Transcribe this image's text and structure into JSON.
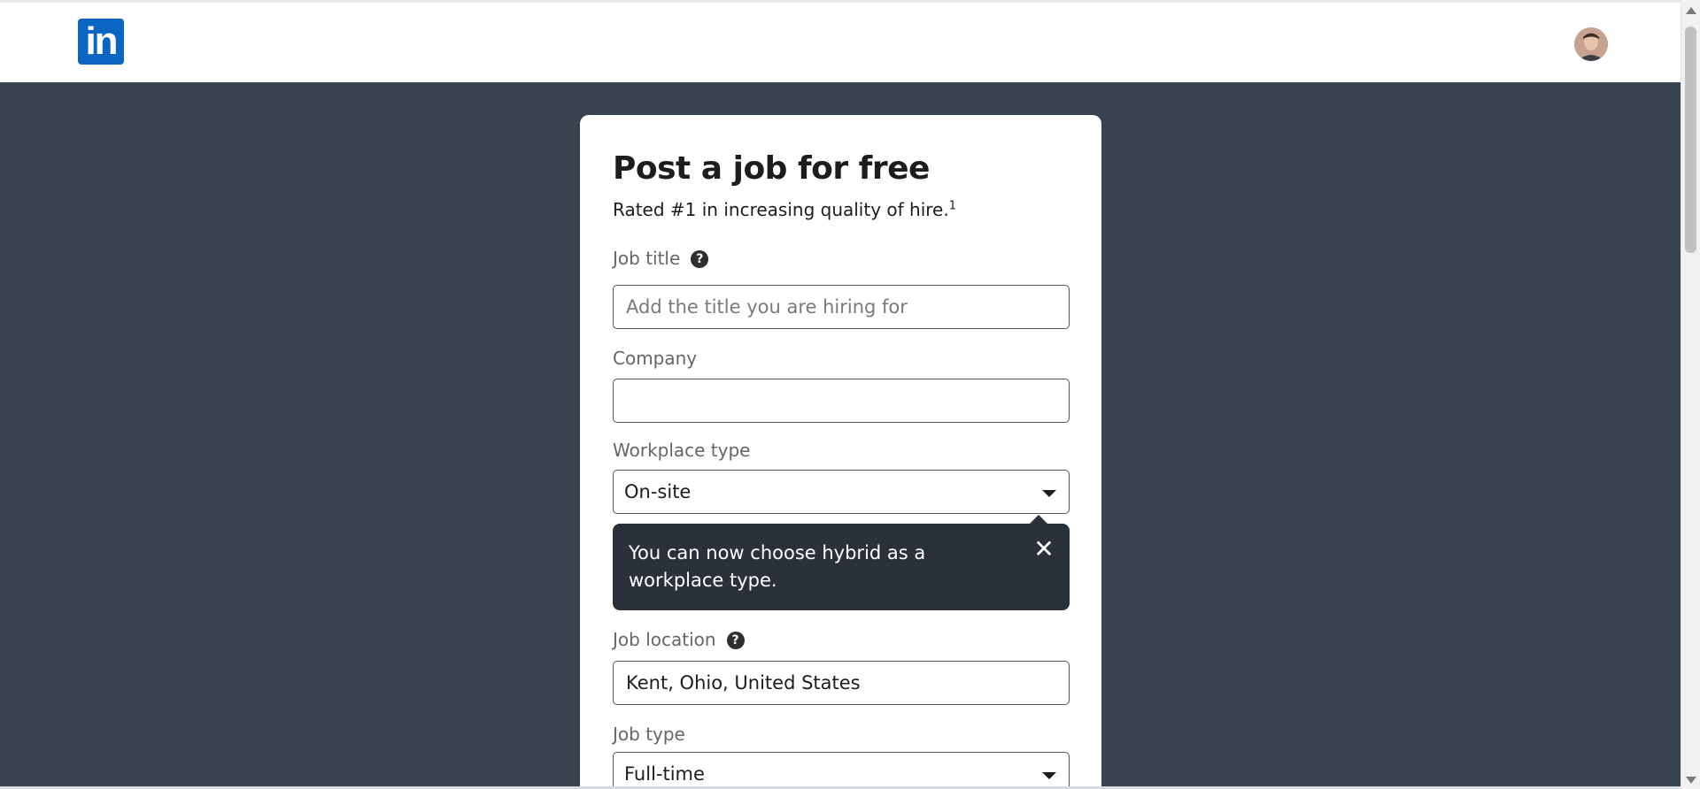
{
  "header": {
    "logo_text": "in"
  },
  "form": {
    "title": "Post a job for free",
    "subtitle": "Rated #1 in increasing quality of hire.",
    "subtitle_footnote": "1",
    "job_title": {
      "label": "Job title",
      "placeholder": "Add the title you are hiring for",
      "value": ""
    },
    "company": {
      "label": "Company",
      "value": ""
    },
    "workplace_type": {
      "label": "Workplace type",
      "value": "On-site"
    },
    "tooltip": {
      "text": "You can now choose hybrid as a workplace type.",
      "close_icon": "close-icon"
    },
    "job_location": {
      "label": "Job location",
      "value": "Kent, Ohio, United States"
    },
    "job_type": {
      "label": "Job type",
      "value": "Full-time"
    },
    "help_icon_glyph": "?"
  },
  "colors": {
    "brand": "#0a66c2",
    "background": "#38434f",
    "tooltip_bg": "#2b3138"
  }
}
